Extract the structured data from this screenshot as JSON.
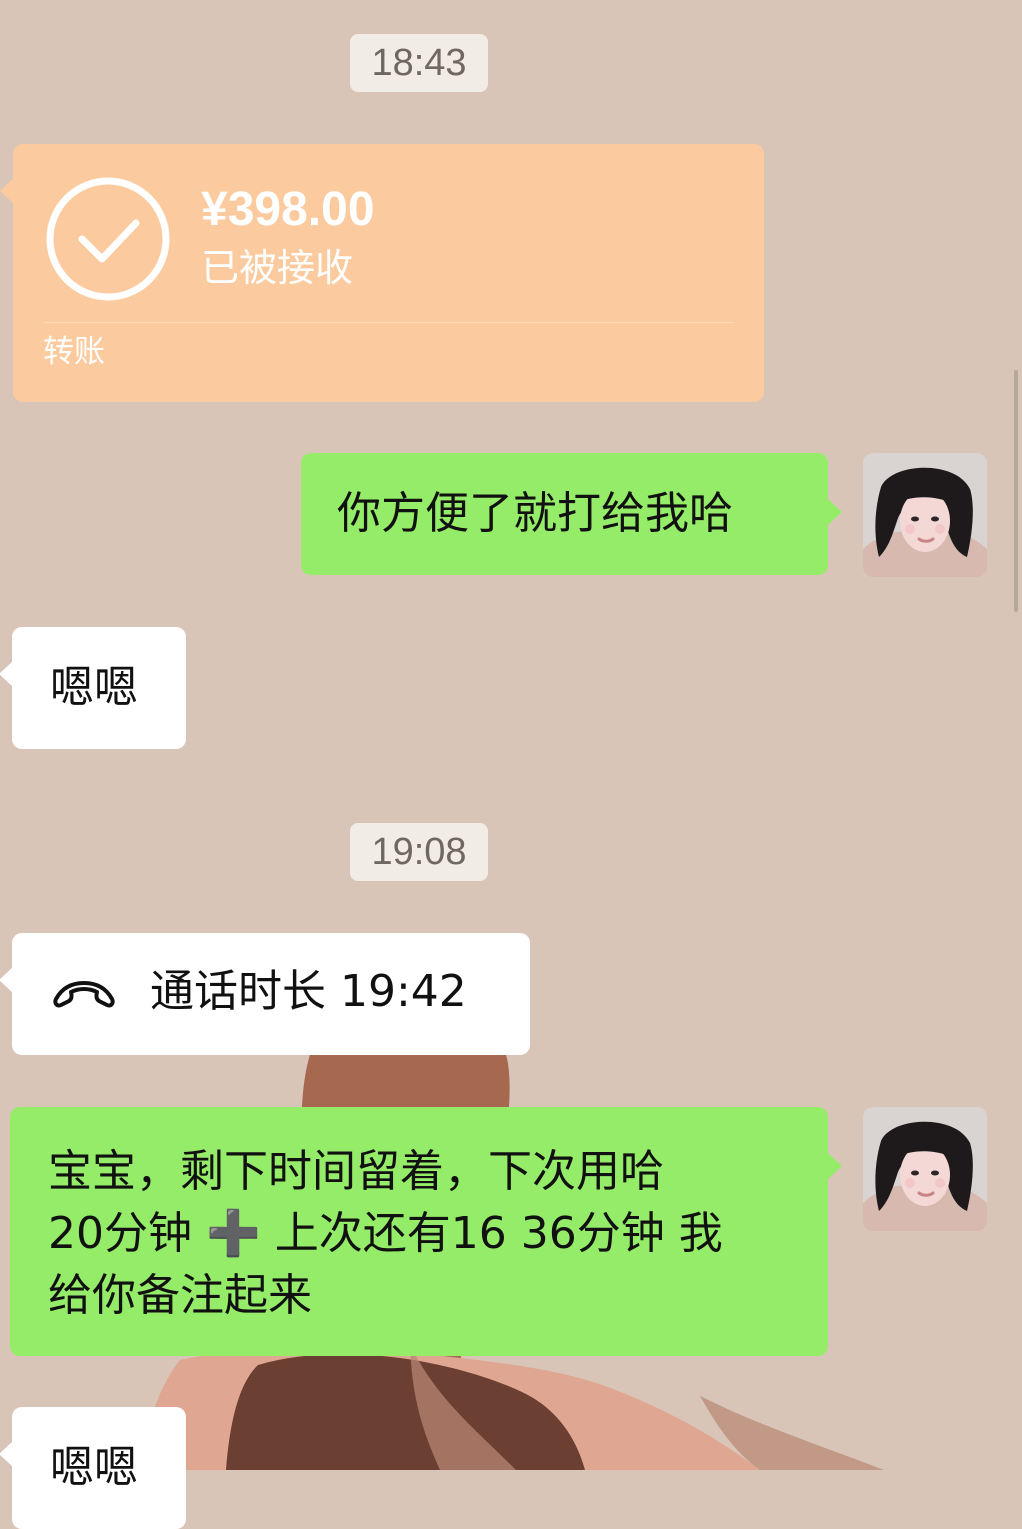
{
  "timestamps": [
    "18:43",
    "19:08"
  ],
  "transfer": {
    "amount": "¥398.00",
    "status": "已被接收",
    "label": "转账"
  },
  "messages": [
    {
      "side": "right",
      "text": "你方便了就打给我哈"
    },
    {
      "side": "left",
      "text": "嗯嗯"
    },
    {
      "side": "left",
      "text": "通话时长 19:42"
    },
    {
      "side": "right",
      "text": "宝宝，剩下时间留着，下次用哈\n20分钟 ➕ 上次还有16 36分钟 我\n给你备注起来"
    },
    {
      "side": "left",
      "text": "嗯嗯"
    }
  ],
  "colors": {
    "background": "#d9c5b7",
    "sent": "#95ec69",
    "received": "#ffffff",
    "transfer": "#fbcb9f",
    "timestamp_bg": "#f2ece7"
  },
  "icons": {
    "transfer_accepted": "check-circle-icon",
    "call": "phone-hangup-icon",
    "avatar": "woman-portrait"
  }
}
